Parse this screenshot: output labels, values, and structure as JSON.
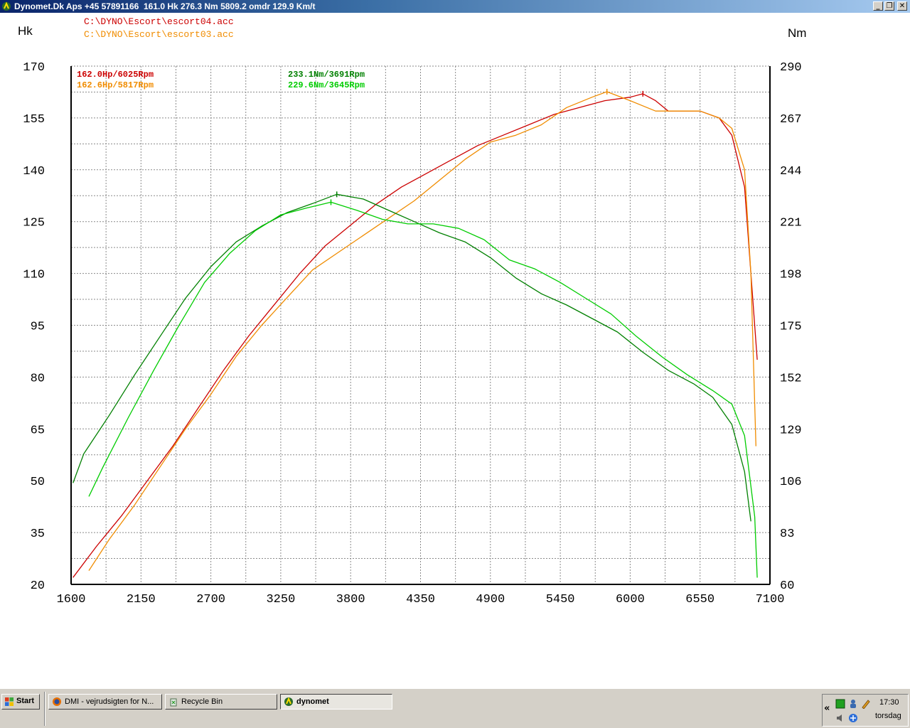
{
  "window": {
    "title": "Dynomet.Dk Aps +45 57891166  161.0 Hk 276.3 Nm 5809.2 omdr 129.9 Km/t",
    "minimize": "_",
    "maximize": "❐",
    "close": "✕",
    "app_icon": "dynomet-icon"
  },
  "chart": {
    "left_unit": "Hk",
    "right_unit": "Nm",
    "files": [
      {
        "text": "C:\\DYNO\\Escort\\escort04.acc",
        "color": "#cc0000"
      },
      {
        "text": "C:\\DYNO\\Escort\\escort03.acc",
        "color": "#f08c00"
      }
    ],
    "peaks": [
      {
        "text": "162.0Hp/6025Rpm",
        "color": "#cc0000"
      },
      {
        "text": "162.6Hp/5817Rpm",
        "color": "#f08c00"
      },
      {
        "text": "233.1Nm/3691Rpm",
        "color": "#008000"
      },
      {
        "text": "229.6Nm/3645Rpm",
        "color": "#00cc00"
      }
    ],
    "y_left_ticks": [
      "170",
      "155",
      "140",
      "125",
      "110",
      "95",
      "80",
      "65",
      "50",
      "35",
      "20"
    ],
    "y_right_ticks": [
      "290",
      "267",
      "244",
      "221",
      "198",
      "175",
      "152",
      "129",
      "106",
      "83",
      "60"
    ],
    "x_ticks": [
      "1600",
      "2150",
      "2700",
      "3250",
      "3800",
      "4350",
      "4900",
      "5450",
      "6000",
      "6550",
      "7100"
    ]
  },
  "chart_data": {
    "type": "line",
    "xlabel": "",
    "ylabel_left": "Hk",
    "ylabel_right": "Nm",
    "xlim": [
      1600,
      7100
    ],
    "ylim_left": [
      20,
      170
    ],
    "ylim_right": [
      60,
      290
    ],
    "grid": true,
    "series": [
      {
        "name": "C:\\DYNO\\Escort\\escort04.acc",
        "quantity": "Hk",
        "axis": "left",
        "color": "#cc0000",
        "x": [
          1615,
          1800,
          2000,
          2200,
          2400,
          2600,
          2800,
          3000,
          3200,
          3400,
          3600,
          3800,
          4000,
          4200,
          4400,
          4600,
          4800,
          5000,
          5200,
          5400,
          5600,
          5800,
          6000,
          6100,
          6200,
          6300,
          6400,
          6550,
          6700,
          6800,
          6900,
          6950,
          7000
        ],
        "y": [
          22,
          31,
          40,
          50,
          60,
          71,
          82,
          92,
          101,
          110,
          118,
          124,
          130,
          135,
          139,
          143,
          147,
          150,
          153,
          156,
          158,
          160,
          161,
          162,
          160,
          157,
          157,
          157,
          155,
          150,
          135,
          110,
          85
        ]
      },
      {
        "name": "C:\\DYNO\\Escort\\escort03.acc",
        "quantity": "Hk",
        "axis": "left",
        "color": "#f08c00",
        "x": [
          1740,
          1900,
          2100,
          2300,
          2500,
          2700,
          2900,
          3100,
          3300,
          3500,
          3700,
          3900,
          4100,
          4300,
          4500,
          4700,
          4900,
          5100,
          5300,
          5500,
          5700,
          5817,
          6000,
          6200,
          6400,
          6550,
          6700,
          6800,
          6900,
          6950,
          6990
        ],
        "y": [
          24,
          33,
          43,
          54,
          65,
          75,
          86,
          95,
          103,
          111,
          116,
          121,
          126,
          131,
          137,
          143,
          148,
          150,
          153,
          158,
          161,
          162.6,
          160,
          157,
          157,
          157,
          155,
          152,
          140,
          110,
          60
        ]
      },
      {
        "name": "233.1Nm/3691Rpm",
        "quantity": "Nm",
        "axis": "right",
        "color": "#008000",
        "x": [
          1615,
          1700,
          1900,
          2100,
          2300,
          2500,
          2700,
          2900,
          3100,
          3300,
          3500,
          3691,
          3900,
          4100,
          4300,
          4500,
          4700,
          4900,
          5100,
          5300,
          5500,
          5700,
          5900,
          6100,
          6300,
          6500,
          6650,
          6800,
          6900,
          6950
        ],
        "y": [
          105,
          118,
          135,
          153,
          170,
          187,
          201,
          212,
          219,
          225,
          229,
          233.1,
          231,
          226,
          221,
          216,
          212,
          205,
          196,
          189,
          184,
          178,
          172,
          163,
          155,
          149,
          143,
          131,
          110,
          88
        ]
      },
      {
        "name": "229.6Nm/3645Rpm",
        "quantity": "Nm",
        "axis": "right",
        "color": "#00cc00",
        "x": [
          1740,
          1850,
          2050,
          2250,
          2450,
          2650,
          2850,
          3050,
          3250,
          3450,
          3645,
          3850,
          4050,
          4250,
          4450,
          4650,
          4850,
          5050,
          5250,
          5450,
          5650,
          5850,
          6050,
          6250,
          6450,
          6650,
          6800,
          6900,
          6980,
          7000
        ],
        "y": [
          99,
          112,
          134,
          155,
          175,
          194,
          207,
          217,
          224,
          227,
          229.6,
          226,
          222,
          220,
          220,
          218,
          213,
          204,
          200,
          194,
          187,
          180,
          170,
          161,
          153,
          146,
          140,
          126,
          90,
          63
        ]
      }
    ]
  },
  "taskbar": {
    "start": "Start",
    "tasks": [
      {
        "label": "DMI - vejrudsigten for N...",
        "icon": "firefox-icon",
        "active": false
      },
      {
        "label": "Recycle Bin",
        "icon": "recycle-bin-icon",
        "active": false
      },
      {
        "label": "dynomet",
        "icon": "dynomet-icon",
        "active": true
      }
    ],
    "tray_expand": "«",
    "time": "17:30",
    "day": "torsdag"
  }
}
